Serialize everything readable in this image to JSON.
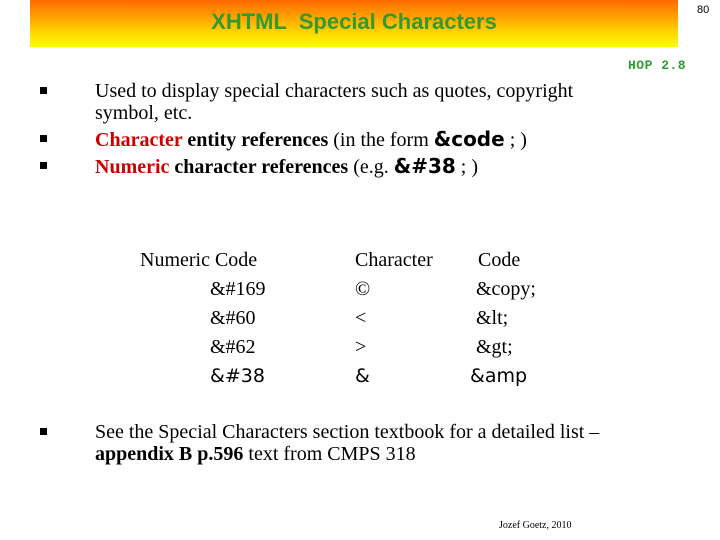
{
  "slide": {
    "title": "XHTML  Special Characters",
    "page_number": "80",
    "reference": "HOP 2.8",
    "footer": "Jozef Goetz, 2010"
  },
  "colors": {
    "title_green": "#339933",
    "highlight_red": "#cc0000",
    "banner_top": "#ff6a00",
    "banner_bottom": "#ffff00"
  },
  "bullets": [
    {
      "text": "Used to display special characters such as quotes, copyright symbol, etc."
    },
    {
      "highlight": "Character",
      "bold_text": " entity references",
      "normal_text": " (in the form ",
      "code": "&code",
      "suffix": " ; )"
    },
    {
      "highlight": "Numeric",
      "bold_text": " character references",
      "normal_text": " (e.g. ",
      "code": "&#38",
      "suffix": " ; )"
    }
  ],
  "table": {
    "headers": {
      "numeric_code": "Numeric Code",
      "character": "Character",
      "code": "Code"
    },
    "rows": [
      {
        "numeric": "&#169",
        "character": "©",
        "code": "&copy;"
      },
      {
        "numeric": "&#60",
        "character": "<",
        "code": "&lt;"
      },
      {
        "numeric": "&#62",
        "character": ">",
        "code": "&gt;"
      },
      {
        "numeric": "&#38",
        "character": "&",
        "code": "&amp"
      }
    ]
  },
  "final_bullet": {
    "text_before": "See the Special Characters section textbook for a detailed list – ",
    "bold_text": "appendix B p.596",
    "text_after": " text from CMPS 318"
  }
}
